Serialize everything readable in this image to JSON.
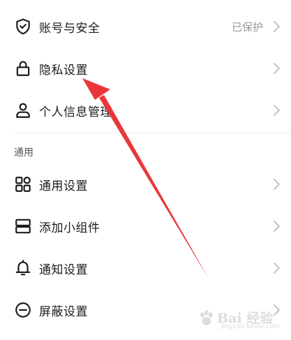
{
  "account": {
    "security": {
      "label": "账号与安全",
      "value": "已保护",
      "icon": "shield-check-icon"
    },
    "privacy": {
      "label": "隐私设置",
      "icon": "lock-icon"
    },
    "personal_info": {
      "label": "个人信息管理",
      "icon": "person-icon"
    }
  },
  "general_section": {
    "title": "通用",
    "items": [
      {
        "label": "通用设置",
        "icon": "grid-icon"
      },
      {
        "label": "添加小组件",
        "icon": "widget-icon"
      },
      {
        "label": "通知设置",
        "icon": "bell-icon"
      },
      {
        "label": "屏蔽设置",
        "icon": "block-icon"
      }
    ]
  },
  "watermark": {
    "main": "Bai 经验",
    "sub": "jingyan.baidu.com"
  },
  "colors": {
    "arrow": "#e8373a",
    "text": "#1c1c1c",
    "muted": "#9a9a9a",
    "chevron": "#bbbbbb"
  }
}
